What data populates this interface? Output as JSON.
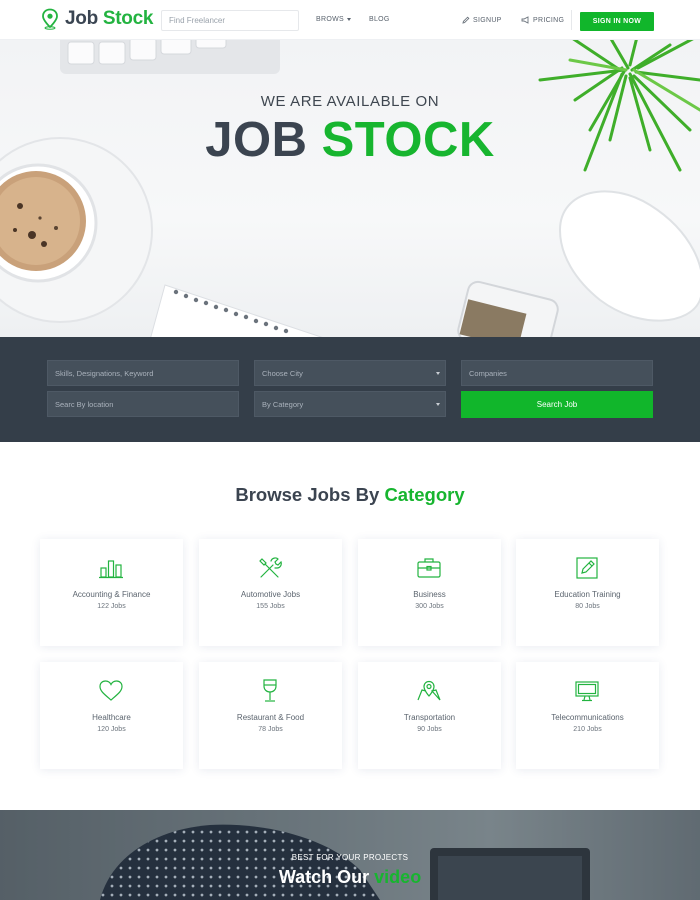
{
  "header": {
    "logo": {
      "word1": "Job",
      "word2": "Stock"
    },
    "search_placeholder": "Find Freelancer",
    "nav": {
      "brows": "BROWS",
      "blog": "BLOG",
      "signup": "SIGNUP",
      "pricing": "PRICING"
    },
    "signin_label": "SIGN IN NOW"
  },
  "hero": {
    "subtitle": "WE ARE AVAILABLE ON",
    "title_part1": "JOB",
    "title_part2": "STOCK"
  },
  "search": {
    "skills_placeholder": "Skills, Designations, Keyword",
    "city_select": "Choose City",
    "companies_placeholder": "Companies",
    "location_placeholder": "Searc By location",
    "category_select": "By Category",
    "button_label": "Search Job"
  },
  "categories": {
    "title_part1": "Browse Jobs By",
    "title_part2": "Category",
    "items": [
      {
        "name": "Accounting & Finance",
        "count": "122 Jobs",
        "icon": "bar-chart-icon"
      },
      {
        "name": "Automotive Jobs",
        "count": "155 Jobs",
        "icon": "tools-icon"
      },
      {
        "name": "Business",
        "count": "300 Jobs",
        "icon": "briefcase-icon"
      },
      {
        "name": "Education Training",
        "count": "80 Jobs",
        "icon": "pencil-square-icon"
      },
      {
        "name": "Healthcare",
        "count": "120 Jobs",
        "icon": "heart-icon"
      },
      {
        "name": "Restaurant & Food",
        "count": "78 Jobs",
        "icon": "wine-glass-icon"
      },
      {
        "name": "Transportation",
        "count": "90 Jobs",
        "icon": "map-pin-icon"
      },
      {
        "name": "Telecommunications",
        "count": "210 Jobs",
        "icon": "monitor-icon"
      }
    ]
  },
  "video": {
    "kicker": "BEST FOR YOUR PROJECTS",
    "title_part1": "Watch Our",
    "title_part2": "video"
  },
  "colors": {
    "accent": "#11b62b",
    "panel": "#343e49",
    "heading": "#3b4450"
  }
}
